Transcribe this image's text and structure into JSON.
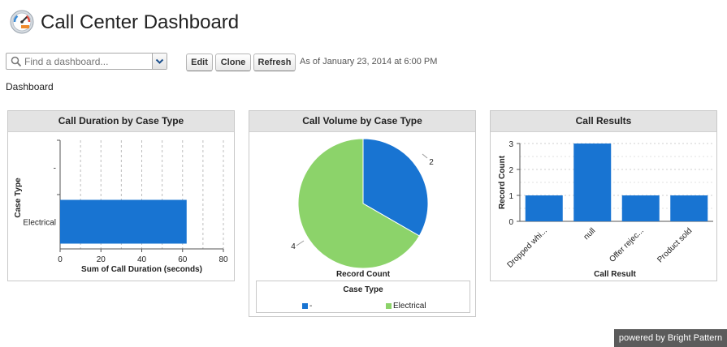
{
  "page": {
    "title": "Call Center Dashboard",
    "section_label": "Dashboard"
  },
  "toolbar": {
    "search_placeholder": "Find a dashboard...",
    "edit_label": "Edit",
    "clone_label": "Clone",
    "refresh_label": "Refresh",
    "as_of": "As of January 23, 2014 at 6:00 PM"
  },
  "icons": {
    "title": "dashboard-gauge-icon",
    "search": "search-icon",
    "dropdown": "chevron-down-icon"
  },
  "colors": {
    "blue": "#1874d2",
    "green": "#8cd36a",
    "header_bg": "#e3e3e3",
    "powered_bg": "#5b5b5b"
  },
  "footer": {
    "powered_by": "powered by Bright Pattern"
  },
  "chart_data": [
    {
      "title": "Call Duration by Case Type",
      "type": "bar",
      "orientation": "horizontal",
      "categories": [
        "-",
        "Electrical"
      ],
      "values": [
        0,
        62
      ],
      "xlabel": "Sum of Call Duration (seconds)",
      "ylabel": "Case Type",
      "xlim": [
        0,
        80
      ],
      "xticks": [
        "0",
        "20",
        "40",
        "60",
        "80"
      ],
      "grid": true,
      "color": "#1874d2"
    },
    {
      "title": "Call Volume by Case Type",
      "type": "pie",
      "categories": [
        "-",
        "Electrical"
      ],
      "values": [
        2,
        4
      ],
      "value_labels": [
        "2",
        "4"
      ],
      "xlabel": "Record Count",
      "legend_title": "Case Type",
      "legend_position": "bottom",
      "colors": [
        "#1874d2",
        "#8cd36a"
      ]
    },
    {
      "title": "Call Results",
      "type": "bar",
      "categories": [
        "Dropped whi...",
        "null",
        "Offer rejec...",
        "Product sold"
      ],
      "values": [
        1,
        3,
        1,
        1
      ],
      "xlabel": "Call Result",
      "ylabel": "Record Count",
      "ylim": [
        0,
        3
      ],
      "yticks": [
        "0",
        "1",
        "2",
        "3"
      ],
      "grid": true,
      "color": "#1874d2"
    }
  ]
}
